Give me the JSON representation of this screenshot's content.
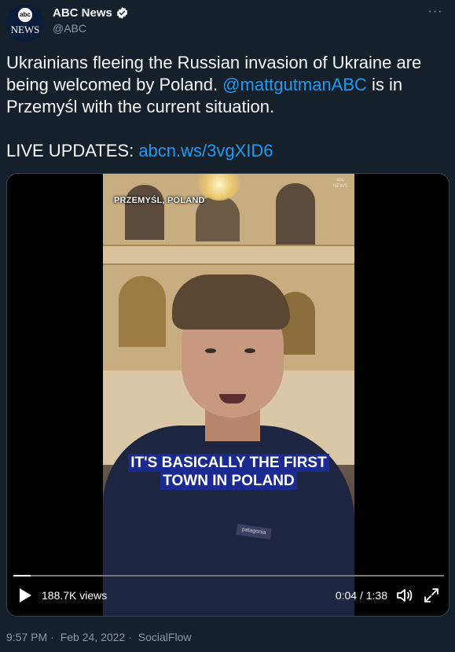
{
  "author": {
    "display_name": "ABC News",
    "handle": "@ABC",
    "avatar_logo": "abc",
    "avatar_text": "NEWS"
  },
  "more_icon": "···",
  "tweet": {
    "line1_prefix": "Ukrainians fleeing the Russian invasion of Ukraine are being welcomed by Poland. ",
    "mention": "@mattgutmanABC",
    "line1_suffix": " is in Przemyśl with the current situation.",
    "live_updates_label": "LIVE UPDATES: ",
    "link": "abcn.ws/3vgXID6"
  },
  "video": {
    "location_overlay": "PRZEMYŚL, POLAND",
    "logo_top": "abc",
    "logo_bottom": "NEWS",
    "caption_line1": "IT'S BASICALLY THE FIRST",
    "caption_line2": "TOWN IN POLAND",
    "jacket_brand": "patagonia",
    "views": "188.7K views",
    "current_time": "0:04",
    "separator": " / ",
    "duration": "1:38",
    "progress_fraction": 0.04
  },
  "meta": {
    "time": "9:57 PM",
    "dot1": "·",
    "date": "Feb 24, 2022",
    "dot2": "·",
    "source": "SocialFlow"
  },
  "colors": {
    "background": "#15202b",
    "link": "#1d9bf0",
    "muted": "#8b98a5",
    "caption_bg": "#1b2a90"
  }
}
